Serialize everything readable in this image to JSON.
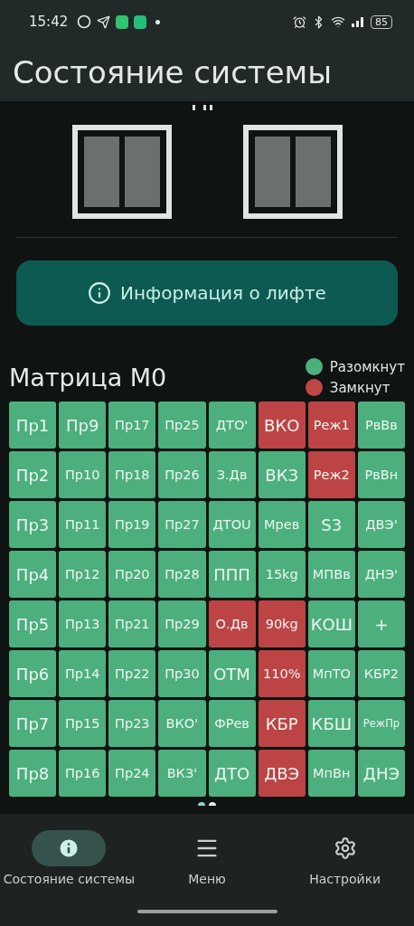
{
  "status_bar": {
    "time": "15:42",
    "battery": "85"
  },
  "app_bar": {
    "title": "Состояние системы"
  },
  "info_button": {
    "label": "Информация о лифте"
  },
  "matrix": {
    "title": "Матрица M0",
    "legend": [
      {
        "label": "Разомкнут",
        "color": "#4caf7d"
      },
      {
        "label": "Замкнут",
        "color": "#c04646"
      }
    ],
    "rows": [
      [
        {
          "label": "Пр1",
          "closed": false
        },
        {
          "label": "Пр9",
          "closed": false
        },
        {
          "label": "Пр17",
          "closed": false
        },
        {
          "label": "Пр25",
          "closed": false
        },
        {
          "label": "ДТО'",
          "closed": false
        },
        {
          "label": "ВКО",
          "closed": true
        },
        {
          "label": "Реж1",
          "closed": true
        },
        {
          "label": "РвВв",
          "closed": false
        }
      ],
      [
        {
          "label": "Пр2",
          "closed": false
        },
        {
          "label": "Пр10",
          "closed": false
        },
        {
          "label": "Пр18",
          "closed": false
        },
        {
          "label": "Пр26",
          "closed": false
        },
        {
          "label": "З.Дв",
          "closed": false
        },
        {
          "label": "ВКЗ",
          "closed": false
        },
        {
          "label": "Реж2",
          "closed": true
        },
        {
          "label": "РвВн",
          "closed": false
        }
      ],
      [
        {
          "label": "Пр3",
          "closed": false
        },
        {
          "label": "Пр11",
          "closed": false
        },
        {
          "label": "Пр19",
          "closed": false
        },
        {
          "label": "Пр27",
          "closed": false
        },
        {
          "label": "ДТОU",
          "closed": false
        },
        {
          "label": "Мрев",
          "closed": false
        },
        {
          "label": "S3",
          "closed": false
        },
        {
          "label": "ДВЭ'",
          "closed": false
        }
      ],
      [
        {
          "label": "Пр4",
          "closed": false
        },
        {
          "label": "Пр12",
          "closed": false
        },
        {
          "label": "Пр20",
          "closed": false
        },
        {
          "label": "Пр28",
          "closed": false
        },
        {
          "label": "ППП",
          "closed": false
        },
        {
          "label": "15kg",
          "closed": false
        },
        {
          "label": "МПВв",
          "closed": false
        },
        {
          "label": "ДНЭ'",
          "closed": false
        }
      ],
      [
        {
          "label": "Пр5",
          "closed": false
        },
        {
          "label": "Пр13",
          "closed": false
        },
        {
          "label": "Пр21",
          "closed": false
        },
        {
          "label": "Пр29",
          "closed": false
        },
        {
          "label": "О.Дв",
          "closed": true
        },
        {
          "label": "90kg",
          "closed": true
        },
        {
          "label": "КОШ",
          "closed": false
        },
        {
          "label": "+",
          "closed": false
        }
      ],
      [
        {
          "label": "Пр6",
          "closed": false
        },
        {
          "label": "Пр14",
          "closed": false
        },
        {
          "label": "Пр22",
          "closed": false
        },
        {
          "label": "Пр30",
          "closed": false
        },
        {
          "label": "ОТМ",
          "closed": false
        },
        {
          "label": "110%",
          "closed": true
        },
        {
          "label": "МпТО",
          "closed": false
        },
        {
          "label": "КБР2",
          "closed": false
        }
      ],
      [
        {
          "label": "Пр7",
          "closed": false
        },
        {
          "label": "Пр15",
          "closed": false
        },
        {
          "label": "Пр23",
          "closed": false
        },
        {
          "label": "ВКО'",
          "closed": false
        },
        {
          "label": "ФРев",
          "closed": false
        },
        {
          "label": "КБР",
          "closed": true
        },
        {
          "label": "КБШ",
          "closed": false
        },
        {
          "label": "РежПр",
          "closed": false
        }
      ],
      [
        {
          "label": "Пр8",
          "closed": false
        },
        {
          "label": "Пр16",
          "closed": false
        },
        {
          "label": "Пр24",
          "closed": false
        },
        {
          "label": "ВКЗ'",
          "closed": false
        },
        {
          "label": "ДТО",
          "closed": false
        },
        {
          "label": "ДВЭ",
          "closed": true
        },
        {
          "label": "МпВн",
          "closed": false
        },
        {
          "label": "ДНЭ",
          "closed": false
        }
      ]
    ]
  },
  "pager": [
    {
      "selected": true
    },
    {
      "selected": false
    }
  ],
  "nav": [
    {
      "label": "Состояние системы",
      "kind": "info",
      "selected": true
    },
    {
      "label": "Меню",
      "kind": "menu",
      "selected": false
    },
    {
      "label": "Настройки",
      "kind": "settings",
      "selected": false
    }
  ]
}
